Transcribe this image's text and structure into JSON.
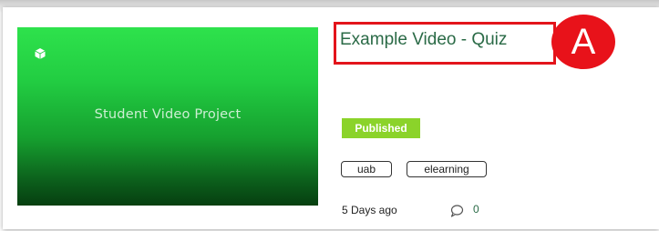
{
  "video": {
    "thumbnail_text": "Student Video Project",
    "title": "Example Video - Quiz",
    "status": "Published",
    "tags": [
      "uab",
      "elearning"
    ],
    "posted": "5 Days ago",
    "comment_count": "0"
  },
  "annotation": {
    "marker_label": "A"
  },
  "icons": {
    "thumbnail_logo": "cube-icon",
    "comments": "comment-bubble-icon"
  },
  "colors": {
    "title": "#2a6a46",
    "status_badge": "#8bd32a",
    "highlight": "#e3141b",
    "thumbnail_top": "#2ee24c",
    "thumbnail_bottom": "#063f10"
  }
}
